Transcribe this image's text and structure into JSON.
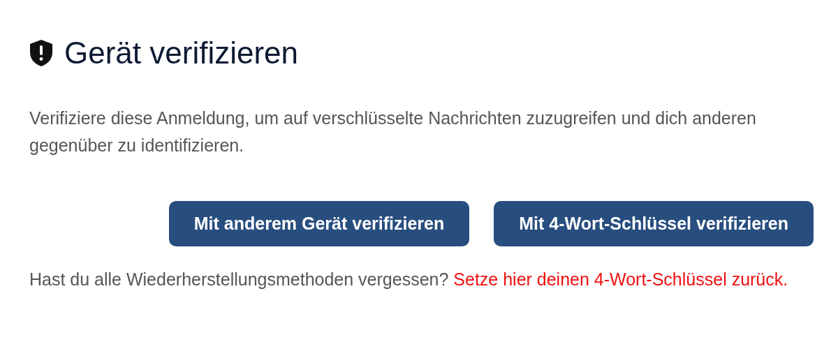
{
  "title": "Gerät verifizieren",
  "description": "Verifiziere diese Anmeldung, um auf verschlüsselte Nachrichten zuzugreifen und dich anderen gegenüber zu identifizieren.",
  "buttons": [
    {
      "label": "Mit anderem Gerät verifizieren"
    },
    {
      "label": "Mit 4-Wort-Schlüssel verifizieren"
    }
  ],
  "footer": {
    "text": "Hast du alle Wiederherstellungsmethoden vergessen?",
    "link": "Setze hier deinen 4-Wort-Schlüssel zurück."
  }
}
